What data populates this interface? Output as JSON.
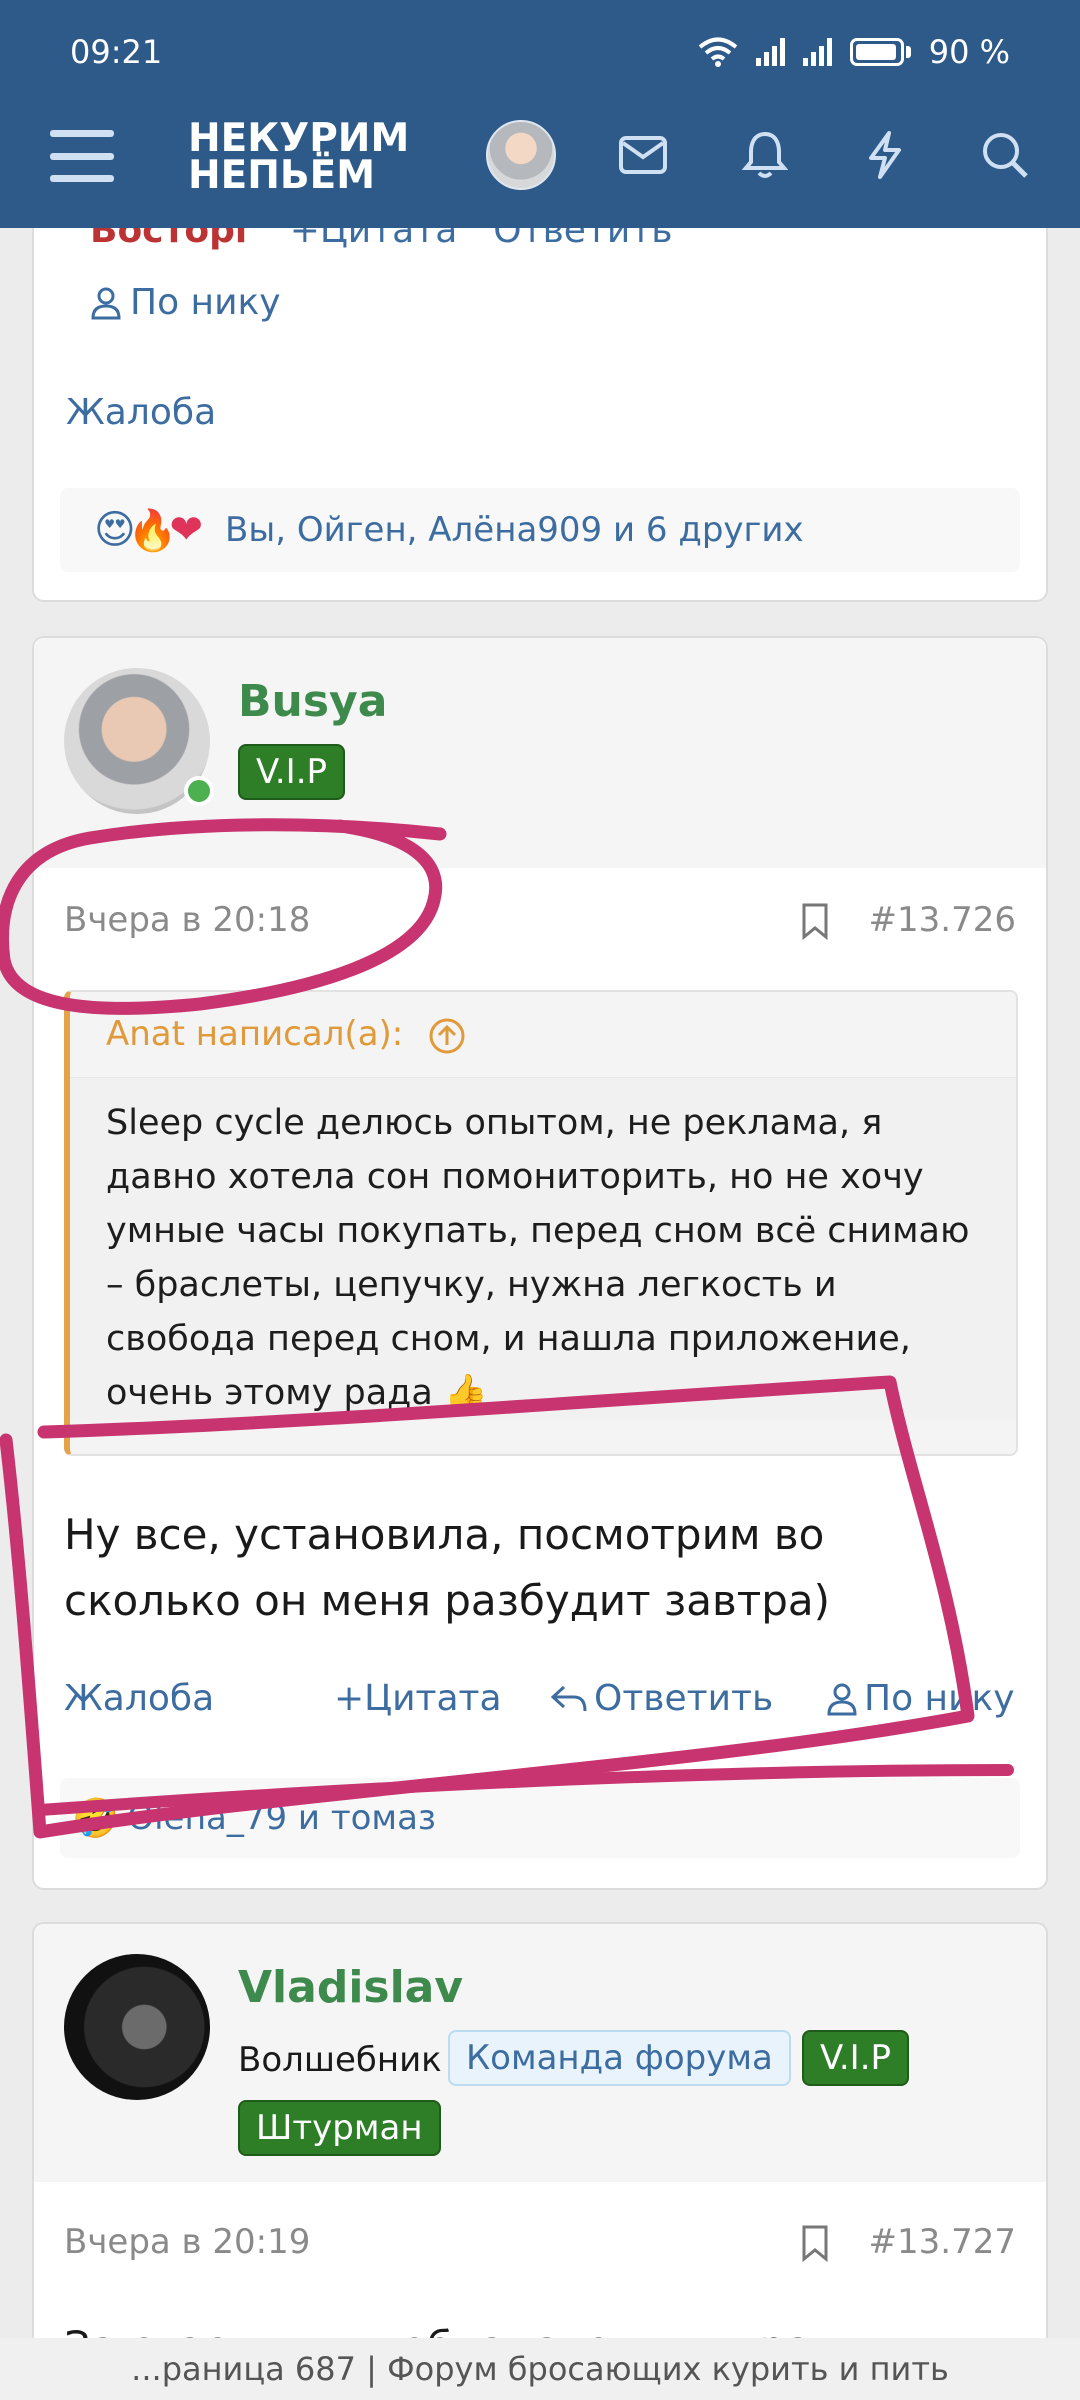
{
  "status": {
    "time": "09:21",
    "battery": "90 %"
  },
  "header": {
    "logo_line1": "НЕКУРИМ",
    "logo_line2": "НЕПЬЁМ"
  },
  "prev_post": {
    "reaction_cut": "Восторг",
    "quote_cut": "Цитата",
    "reply_cut": "Ответить",
    "by_nick": "По нику",
    "report": "Жалоба",
    "reactions_text": "Вы, Ойген, Алёна909 и 6 других"
  },
  "post1": {
    "username": "Busya",
    "badge": "V.I.P",
    "date": "Вчера в 20:18",
    "post_number": "#13.726",
    "quote_author": "Anat написал(а):",
    "quote_text": "Sleep cycle делюсь опытом, не реклама, я давно хотела сон помониторить, но не хочу умные часы покупать, перед сном всё снимаю – браслеты, цепучку, нужна легкость и свобода перед сном, и нашла приложение, очень этому рада",
    "text": "Ну все, установила, посмотрим во сколько он меня разбудит завтра)",
    "report": "Жалоба",
    "quote": "Цитата",
    "reply": "Ответить",
    "by_nick": "По нику",
    "reactions_text": "Olena_79 и томаз"
  },
  "post2": {
    "username": "Vladislav",
    "title": "Волшебник",
    "badge_team": "Команда форума",
    "badge_vip": "V.I.P",
    "badge_navigator": "Штурман",
    "date": "Вчера в 20:19",
    "post_number": "#13.727",
    "text_cut": "За счастливых обладательниц рад"
  },
  "footer": {
    "text": "...раница 687 | Форум бросающих курить и пить"
  },
  "colors": {
    "header": "#2e5a8a",
    "link": "#3d6da0",
    "username": "#3e8a4c",
    "vip": "#2e7d27",
    "annotation": "#c8346f"
  }
}
